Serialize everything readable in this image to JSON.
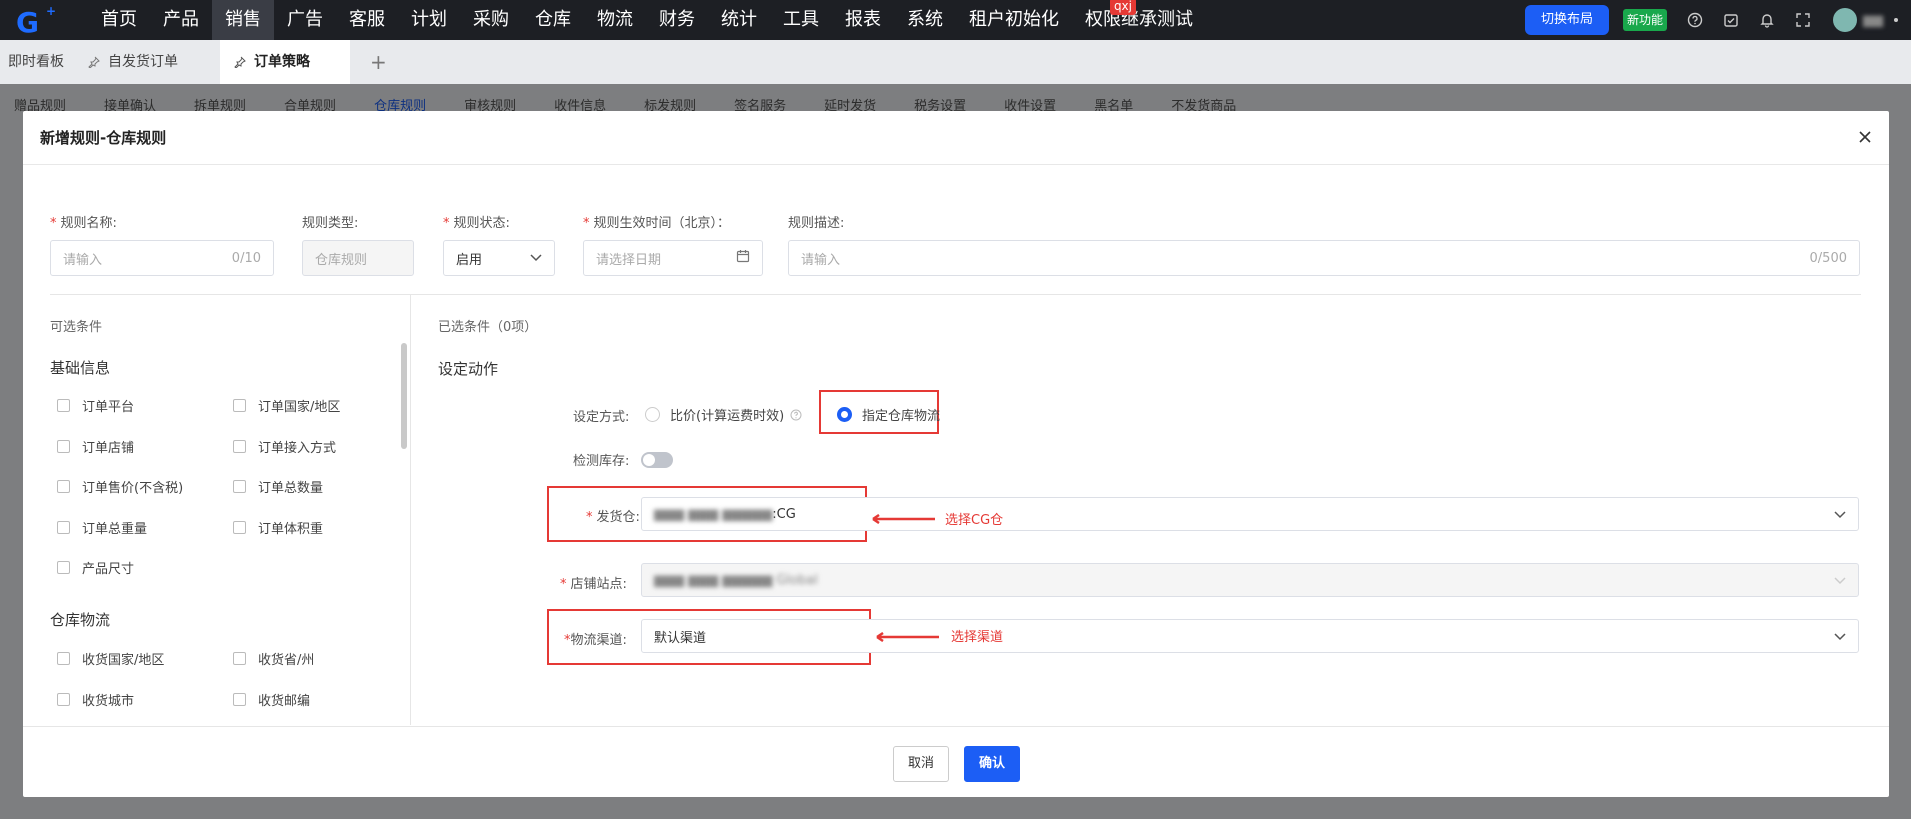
{
  "topnav": {
    "logo_text": "G",
    "items": [
      "首页",
      "产品",
      "销售",
      "广告",
      "客服",
      "计划",
      "采购",
      "仓库",
      "物流",
      "财务",
      "统计",
      "工具",
      "报表",
      "系统",
      "租户初始化",
      "权限继承测试"
    ],
    "active_index": 2,
    "badge": "qxj",
    "layout_button": "切换布局",
    "new_feature": "新功能",
    "username": "▆▆"
  },
  "tabs": {
    "items": [
      "即时看板",
      "自发货订单",
      "订单策略"
    ],
    "active_index": 2
  },
  "subtabs": {
    "items": [
      "赠品规则",
      "接单确认",
      "拆单规则",
      "合单规则",
      "仓库规则",
      "审核规则",
      "收件信息",
      "标发规则",
      "签名服务",
      "延时发货",
      "税务设置",
      "收件设置",
      "黑名单",
      "不发货商品"
    ],
    "active_index": 4
  },
  "modal": {
    "title": "新增规则-仓库规则",
    "fields": {
      "rule_name": {
        "label": "规则名称:",
        "placeholder": "请输入",
        "counter": "0/10"
      },
      "rule_type": {
        "label": "规则类型:",
        "value": "仓库规则"
      },
      "rule_status": {
        "label": "规则状态:",
        "value": "启用"
      },
      "rule_time": {
        "label": "规则生效时间（北京）：",
        "placeholder": "请选择日期"
      },
      "rule_desc": {
        "label": "规则描述:",
        "placeholder": "请输入",
        "counter": "0/500"
      }
    },
    "left": {
      "title": "可选条件",
      "groups": [
        {
          "name": "基础信息",
          "items": [
            "订单平台",
            "订单国家/地区",
            "订单店铺",
            "订单接入方式",
            "订单售价(不含税)",
            "订单总数量",
            "订单总重量",
            "订单体积重",
            "产品尺寸"
          ]
        },
        {
          "name": "仓库物流",
          "items": [
            "收货国家/地区",
            "收货省/州",
            "收货城市",
            "收货邮编"
          ]
        }
      ]
    },
    "right": {
      "selected_title": "已选条件（0项）",
      "action_title": "设定动作",
      "mode_label": "设定方式:",
      "mode_options": [
        "比价(计算运费时效)",
        "指定仓库物流"
      ],
      "mode_selected": 1,
      "stock_label": "检测库存:",
      "warehouse_label": "发货仓:",
      "warehouse_value_hidden": "▆▆▆ ▆▆▆ ▆▆▆▆▆",
      "warehouse_value_suffix": ":CG",
      "store_label": "店铺站点:",
      "store_value": "▆▆▆ ▆▆▆ ▆▆▆▆▆ Global",
      "channel_label": "物流渠道:",
      "channel_value": "默认渠道",
      "annotation_warehouse": "选择CG仓",
      "annotation_channel": "选择渠道"
    },
    "footer": {
      "cancel": "取消",
      "confirm": "确认"
    }
  }
}
